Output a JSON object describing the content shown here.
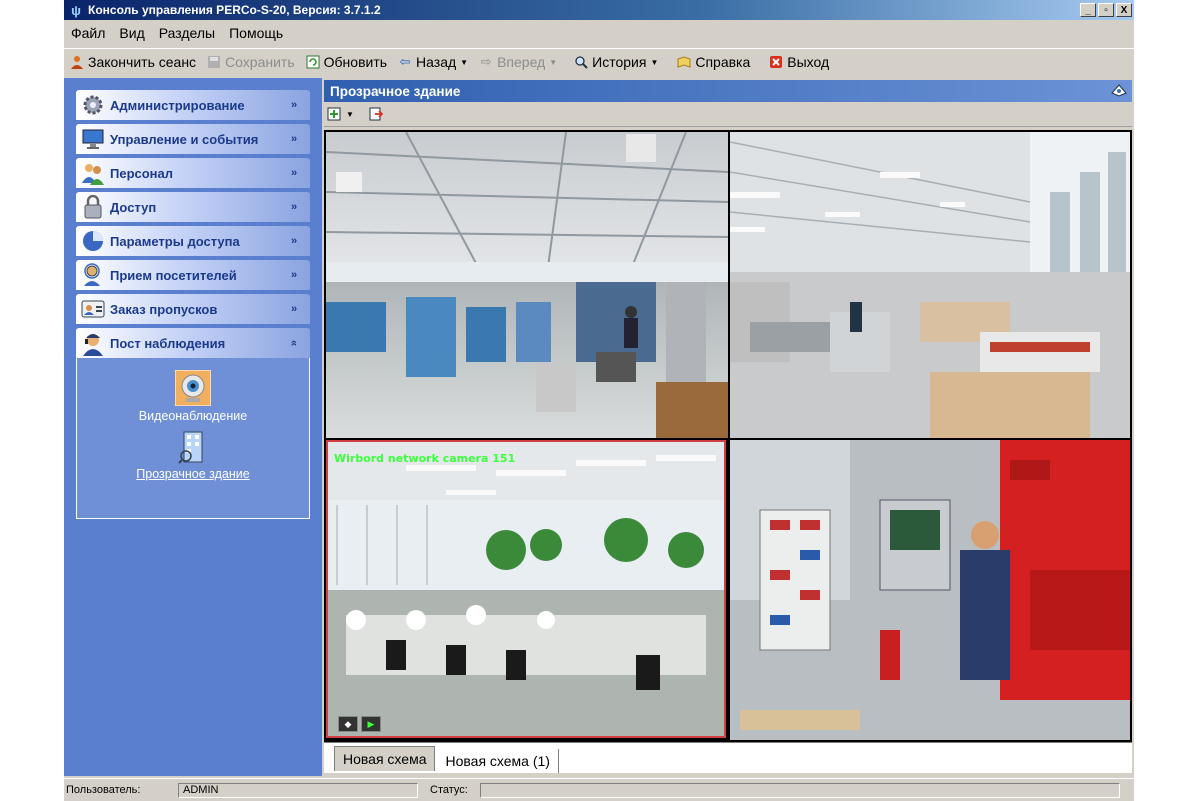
{
  "window": {
    "title": "Консоль управления PERCo-S-20, Версия: 3.7.1.2",
    "buttons": [
      "_",
      "▫",
      "X"
    ]
  },
  "menu": [
    {
      "label": "Файл"
    },
    {
      "label": "Вид"
    },
    {
      "label": "Разделы"
    },
    {
      "label": "Помощь"
    }
  ],
  "toolbar": {
    "end_session": "Закончить сеанс",
    "save": "Сохранить",
    "refresh": "Обновить",
    "back": "Назад",
    "forward": "Вперед",
    "history": "История",
    "help": "Справка",
    "exit": "Выход"
  },
  "sidebar": {
    "items": [
      {
        "label": "Администрирование",
        "icon": "gear-icon"
      },
      {
        "label": "Управление и события",
        "icon": "monitor-icon"
      },
      {
        "label": "Персонал",
        "icon": "people-icon"
      },
      {
        "label": "Доступ",
        "icon": "lock-icon"
      },
      {
        "label": "Параметры доступа",
        "icon": "pie-icon"
      },
      {
        "label": "Прием посетителей",
        "icon": "visitor-icon"
      },
      {
        "label": "Заказ пропусков",
        "icon": "id-card-icon"
      },
      {
        "label": "Пост наблюдения",
        "icon": "guard-icon"
      }
    ],
    "subitems": [
      {
        "label": "Видеонаблюдение",
        "icon": "webcam-icon"
      },
      {
        "label": "Прозрачное здание",
        "icon": "building-icon"
      }
    ]
  },
  "main": {
    "title": "Прозрачное здание"
  },
  "cameras": {
    "label": "Wirbord network camera 151"
  },
  "tabs": [
    {
      "label": "Новая схема",
      "active": true
    },
    {
      "label": "Новая схема (1)",
      "active": false
    }
  ],
  "status": {
    "user_label": "Пользователь:",
    "user_value": "ADMIN",
    "status_label": "Статус:"
  }
}
